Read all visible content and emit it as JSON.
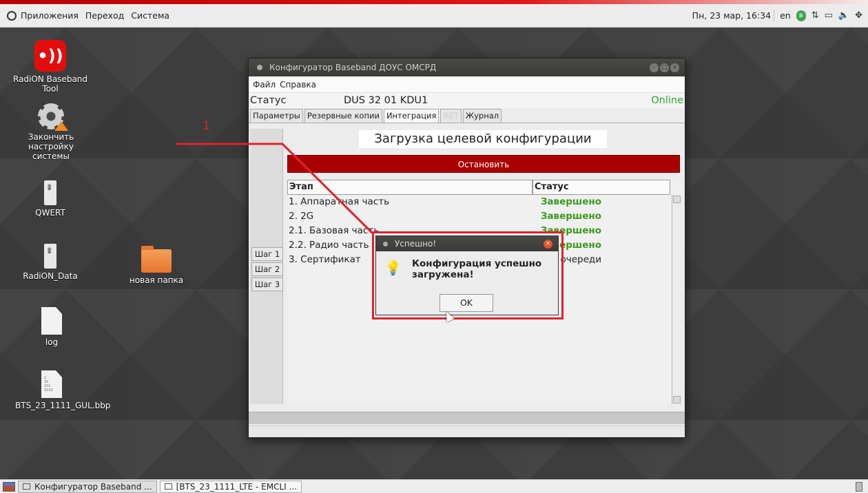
{
  "top_panel": {
    "menu": [
      "Приложения",
      "Переход",
      "Система"
    ],
    "datetime": "Пн, 23 мар, 16:34",
    "keyboard_layout": "en"
  },
  "desktop_icons": [
    {
      "label": "RadiON Baseband Tool",
      "icon": "radion-icon"
    },
    {
      "label": "Закончить настройку системы",
      "icon": "settings-gear-icon"
    },
    {
      "label": "QWERT",
      "icon": "usb-drive-icon"
    },
    {
      "label": "RadiON_Data",
      "icon": "usb-drive-icon"
    },
    {
      "label": "новая папка",
      "icon": "folder-icon"
    },
    {
      "label": "log",
      "icon": "text-file-icon"
    },
    {
      "label": "BTS_23_1111_GUL.bbp",
      "icon": "binary-file-icon"
    }
  ],
  "main_window": {
    "title": "Конфигуратор Baseband ДОУС ОМСРД",
    "menu": [
      "Файл",
      "Справка"
    ],
    "status_label": "Статус",
    "node_name": "DUS 32 01 KDU1",
    "connection_status": "Online",
    "tabs": [
      {
        "label": "Параметры",
        "state": "normal"
      },
      {
        "label": "Резервные копии",
        "state": "normal"
      },
      {
        "label": "Интеграция",
        "state": "active"
      },
      {
        "label": "RET",
        "state": "disabled"
      },
      {
        "label": "Журнал",
        "state": "normal"
      }
    ],
    "steps": [
      "Шаг 1",
      "Шаг 2",
      "Шаг 3"
    ],
    "content_title": "Загрузка целевой конфигурации",
    "stop_button": "Остановить",
    "table": {
      "headers": [
        "Этап",
        "Статус"
      ],
      "rows": [
        {
          "stage": "1. Аппаратная часть",
          "status": "Завершено"
        },
        {
          "stage": "2. 2G",
          "status": "Завершено"
        },
        {
          "stage": "2.1. Базовая часть",
          "status": "Завершено"
        },
        {
          "stage": "2.2. Радио часть",
          "status": "Завершено"
        },
        {
          "stage": "3. Сертификат",
          "status": "В очереди"
        }
      ]
    }
  },
  "annotation": {
    "label": "1",
    "color": "#e0222a"
  },
  "dialog": {
    "title": "Успешно!",
    "message": "Конфигурация успешно загружена!",
    "ok_button": "OK"
  },
  "taskbar": {
    "items": [
      "Конфигуратор Baseband ...",
      "[BTS_23_1111_LTE - EMCLI ..."
    ]
  },
  "colors": {
    "accent_red": "#e0222a",
    "stop_red": "#a90000",
    "online_green": "#2ea22e",
    "done_green": "#3a9a1a"
  }
}
